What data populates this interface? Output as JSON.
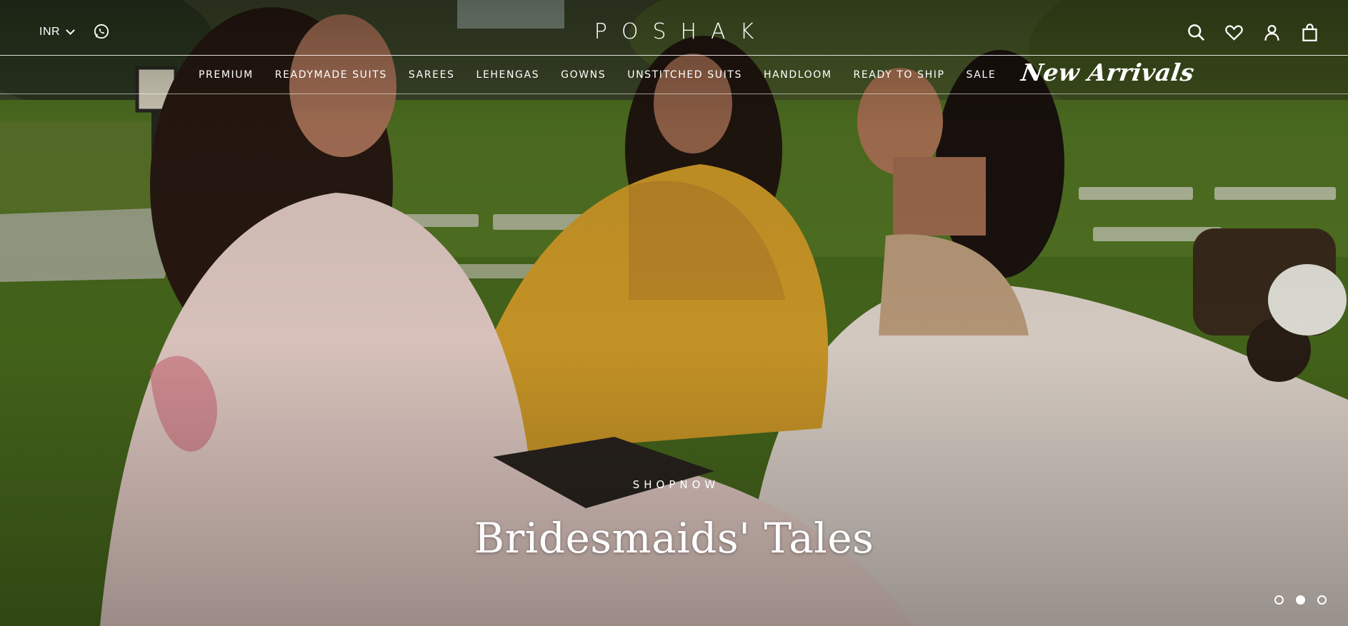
{
  "header": {
    "currency": "INR",
    "brand": "POSHAK",
    "icons": [
      "whatsapp-icon",
      "search-icon",
      "wishlist-heart-icon",
      "account-icon",
      "cart-bag-icon"
    ]
  },
  "nav": {
    "items": [
      "PREMIUM",
      "READYMADE SUITS",
      "SAREES",
      "LEHENGAS",
      "GOWNS",
      "UNSTITCHED SUITS",
      "HANDLOOM",
      "READY TO SHIP",
      "SALE"
    ],
    "featured": "New Arrivals"
  },
  "hero": {
    "cta": "SHOPNOW",
    "title": "Bridesmaids' Tales",
    "slide_count": 3,
    "active_slide": 2
  },
  "colors": {
    "text": "#ffffff",
    "grass": "#4e6b22",
    "mustard": "#d9a22a",
    "blush": "#efd6cf"
  }
}
